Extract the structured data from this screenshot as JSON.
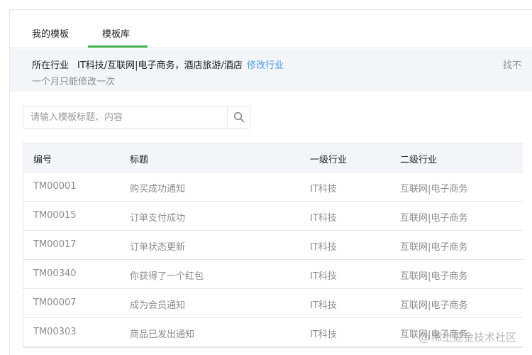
{
  "tabs": [
    {
      "label": "我的模板"
    },
    {
      "label": "模板库",
      "active": true
    }
  ],
  "notice": {
    "label": "所在行业",
    "industries": "IT科技/互联网|电子商务，酒店旅游/酒店",
    "modify_link": "修改行业",
    "limit_text": "一个月只能修改一次",
    "right_cut_text": "找不"
  },
  "search": {
    "placeholder": "请输入模板标题、内容",
    "icon": "search-icon"
  },
  "table": {
    "columns": [
      "编号",
      "标题",
      "一级行业",
      "二级行业"
    ],
    "rows": [
      [
        "TM00001",
        "购买成功通知",
        "IT科技",
        "互联网|电子商务"
      ],
      [
        "TM00015",
        "订单支付成功",
        "IT科技",
        "互联网|电子商务"
      ],
      [
        "TM00017",
        "订单状态更新",
        "IT科技",
        "互联网|电子商务"
      ],
      [
        "TM00340",
        "你获得了一个红包",
        "IT科技",
        "互联网|电子商务"
      ],
      [
        "TM00007",
        "成为会员通知",
        "IT科技",
        "互联网|电子商务"
      ],
      [
        "TM00303",
        "商品已发出通知",
        "IT科技",
        "互联网|电子商务"
      ]
    ]
  },
  "watermark": {
    "at": "@",
    "text": "稀土掘金技术社区"
  },
  "colors": {
    "accent": "#44b549",
    "link": "#459ae9",
    "muted": "#8d8d8d",
    "notice_bg": "#f4f5f9",
    "border": "#e7e7eb"
  }
}
